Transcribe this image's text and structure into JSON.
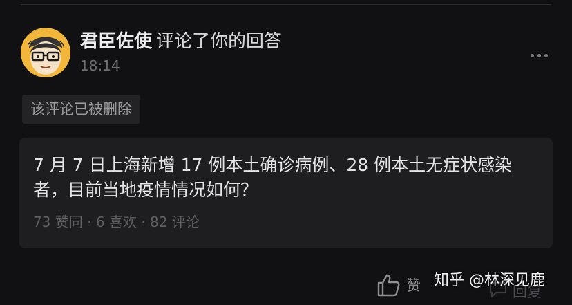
{
  "notification": {
    "author": "君臣佐使",
    "action": "评论了你的回答",
    "time": "18:14"
  },
  "comment": {
    "status": "该评论已被删除"
  },
  "question": {
    "title": "7 月 7 日上海新增 17 例本土确诊病例、28 例本土无症状感染者，目前当地疫情情况如何？",
    "stats": "73 赞同 · 6 喜欢 · 82 评论"
  },
  "footer": {
    "like_label": "赞",
    "faint_label": "回复",
    "watermark": "知乎 @林深见鹿"
  },
  "icons": {
    "avatar": "cartoon-avatar-with-glasses",
    "more": "more-horizontal-icon",
    "like": "thumbs-up-icon",
    "reply": "reply-icon"
  },
  "colors": {
    "background": "#111113",
    "card": "#1e1e20",
    "tag": "#232325",
    "avatar_bg": "#f2b63a"
  }
}
